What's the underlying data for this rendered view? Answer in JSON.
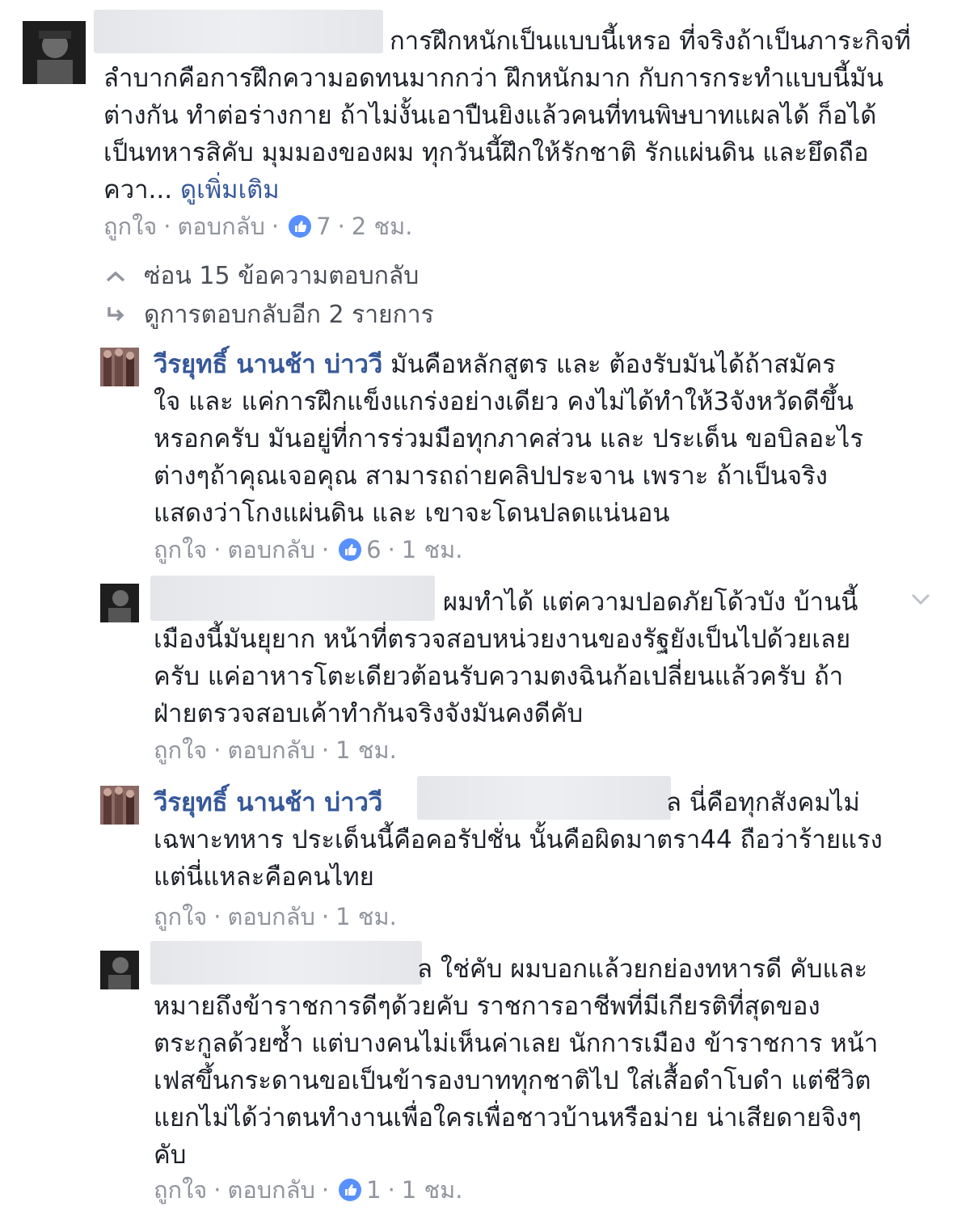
{
  "comment": {
    "text_line1": "การฝึกหนักเป็นแบบนี้เหรอ ที่จริงถ้าเป็นภาระกิจที่",
    "text_rest": "ลำบากคือการฝึกความอดทนมากกว่า ฝึกหนักมาก กับการกระทำแบบนี้มัน\nต่างกัน ทำต่อร่างกาย ถ้าไม่งั้นเอาปืนยิงแล้วคนที่ทนพิษบาทแผลได้ ก็อได้\nเป็นทหารสิคับ มุมมองของผม ทุกวันนี้ฝึกให้รักชาติ รักแผ่นดิน และยึดถือ\nควา...",
    "see_more": "ดูเพิ่มเติม",
    "like": "ถูกใจ",
    "reply": "ตอบกลับ",
    "reactions": "7",
    "time": "2 ชม."
  },
  "replies_toggle": {
    "hide_label": "ซ่อน 15 ข้อความตอบกลับ",
    "more_label": "ดูการตอบกลับอีก 2 รายการ"
  },
  "replies": [
    {
      "name": "วีรยุทธิ์ นานช้า บ่าววี",
      "text_first": " มันคือหลักสูตร และ ต้องรับมันได้ถ้าสมัคร",
      "text_rest": "ใจ และ แค่การฝึกแข็งแกร่งอย่างเดียว คงไม่ได้ทำให้3จังหวัดดีขึ้น\nหรอกครับ มันอยู่ที่การร่วมมือทุกภาคส่วน และ ประเด็น ขอบิลอะไร\nต่างๆถ้าคุณเจอคุณ สามารถถ่ายคลิปประจาน เพราะ ถ้าเป็นจริง\nแสดงว่าโกงแผ่นดิน และ เขาจะโดนปลดแน่นอน",
      "like": "ถูกใจ",
      "reply": "ตอบกลับ",
      "reactions": "6",
      "time": "1 ชม."
    },
    {
      "text_first": "ผมทำได้ แต่ความปอดภัยโด้วบัง บ้านนี้",
      "text_rest": "เมืองนี้มันยุยาก หน้าที่ตรวจสอบหน่วยงานของรัฐยังเป็นไปด้วยเลย\nครับ แค่อาหารโตะเดียวต้อนรับความตงฉินก้อเปลี่ยนแล้วครับ ถ้า\nฝ่ายตรวจสอบเค้าทำกันจริงจังมันคงดีคับ",
      "like": "ถูกใจ",
      "reply": "ตอบกลับ",
      "time": "1 ชม."
    },
    {
      "name": "วีรยุทธิ์ นานช้า บ่าววี",
      "text_first": "ล นี่คือทุกสังคมไม่",
      "text_rest": "เฉพาะทหาร ประเด็นนี้คือคอรัปชั่น นั้นคือผิดมาตรา44 ถือว่าร้ายแรง\nแต่นี่แหละคือคนไทย",
      "like": "ถูกใจ",
      "reply": "ตอบกลับ",
      "time": "1 ชม."
    },
    {
      "text_first": "ล ใช่คับ ผมบอกแล้วยกย่องทหารดี คับและ",
      "text_rest": "หมายถึงข้าราชการดีๆด้วยคับ ราชการอาชีพที่มีเกียรติที่สุดของ\nตระกูลด้วยซ้ำ แต่บางคนไม่เห็นค่าเลย นักการเมือง ข้าราชการ หน้า\nเฟสขึ้นกระดานขอเป็นข้ารองบาททุกชาติไป ใส่เสื้อดำโบดำ แต่ชีวิต\nแยกไม่ได้ว่าตนทำงานเพื่อใครเพื่อชาวบ้านหรือม่าย น่าเสียดายจิงๆ\nคับ",
      "like": "ถูกใจ",
      "reply": "ตอบกลับ",
      "reactions": "1",
      "time": "1 ชม."
    }
  ],
  "colors": {
    "name": "#365899",
    "meta": "#90949c",
    "like_badge": "#5890ff",
    "blur": "#e4e6ea"
  }
}
